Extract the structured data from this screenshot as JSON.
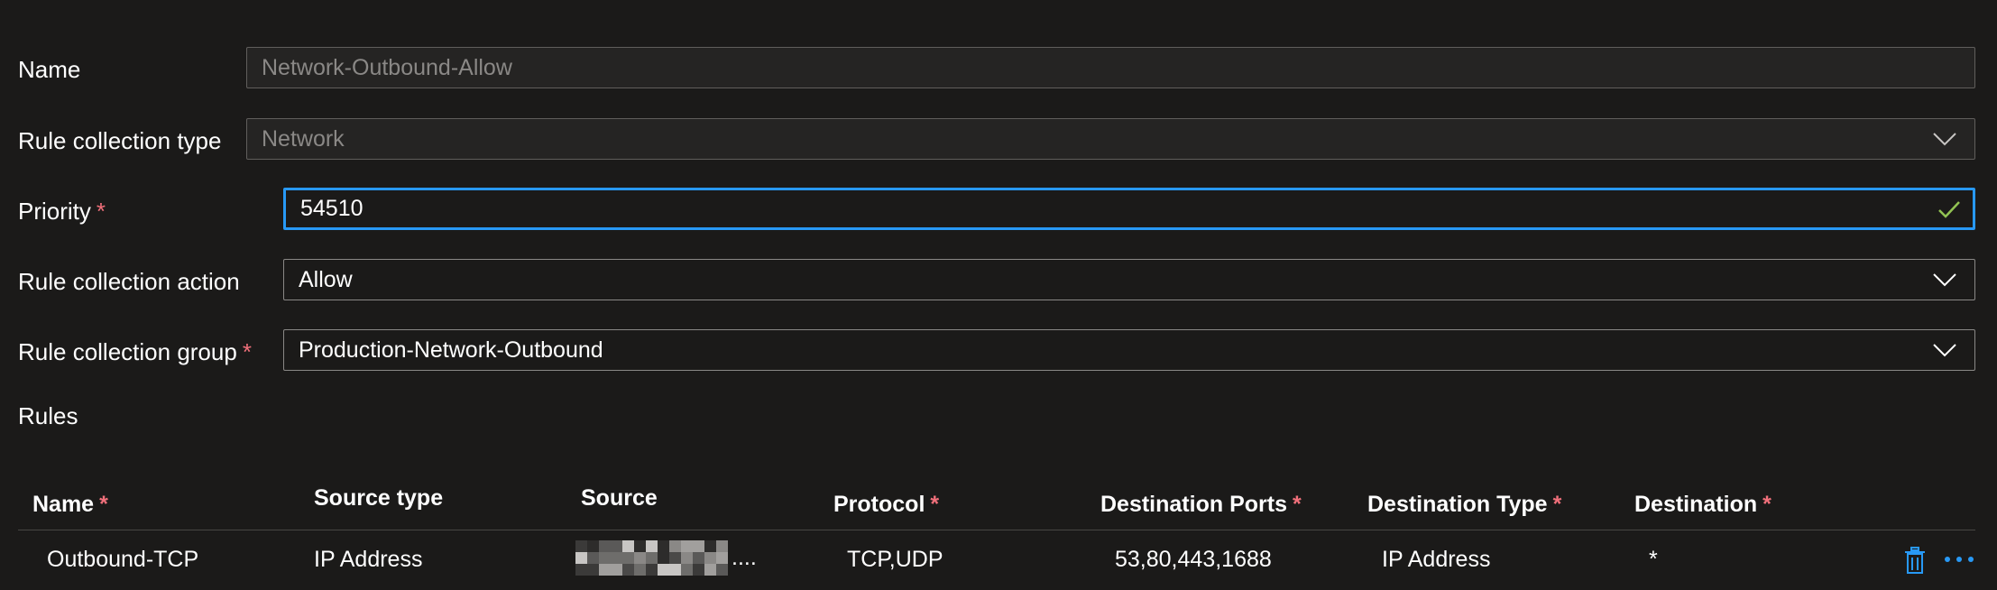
{
  "form": {
    "name": {
      "label": "Name",
      "value": "Network-Outbound-Allow"
    },
    "rule_collection_type": {
      "label": "Rule collection type",
      "value": "Network"
    },
    "priority": {
      "label": "Priority",
      "required": "*",
      "value": "54510"
    },
    "rule_collection_action": {
      "label": "Rule collection action",
      "value": "Allow"
    },
    "rule_collection_group": {
      "label": "Rule collection group",
      "required": "*",
      "value": "Production-Network-Outbound"
    }
  },
  "rules": {
    "label": "Rules",
    "columns": [
      {
        "label": "Name",
        "required": "*"
      },
      {
        "label": "Source type"
      },
      {
        "label": "Source"
      },
      {
        "label": "Protocol",
        "required": "*"
      },
      {
        "label": "Destination Ports",
        "required": "*"
      },
      {
        "label": "Destination Type",
        "required": "*"
      },
      {
        "label": "Destination",
        "required": "*"
      }
    ],
    "rows": [
      {
        "name": "Outbound-TCP",
        "source_type": "IP Address",
        "source_suffix": "....",
        "protocol": "TCP,UDP",
        "destination_ports": "53,80,443,1688",
        "destination_type": "IP Address",
        "destination": "*"
      }
    ]
  },
  "icons": {
    "dropdown": "chevron-down-icon",
    "valid": "checkmark-icon",
    "delete": "trash-icon",
    "more": "more-options-icon"
  },
  "colors": {
    "background": "#1b1a19",
    "focus_border": "#2899f5",
    "required": "#f1707b",
    "valid_check": "#92c353",
    "action_icon": "#2899f5"
  }
}
